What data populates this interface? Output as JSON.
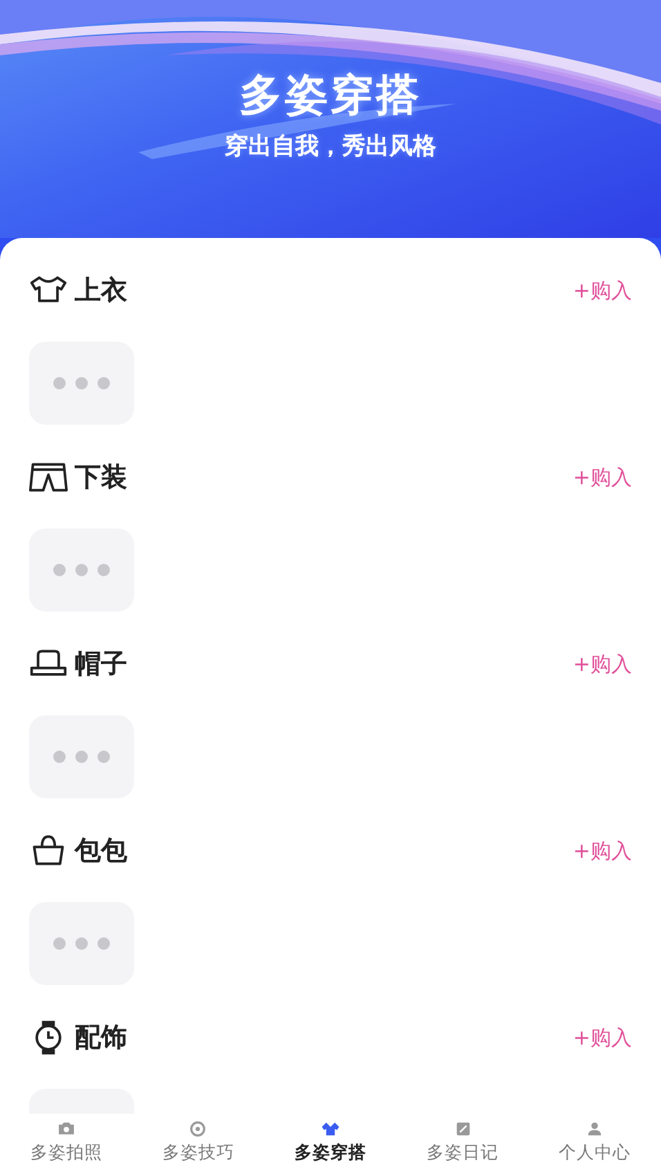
{
  "header": {
    "title": "多姿穿搭",
    "subtitle": "穿出自我，秀出风格"
  },
  "categories": [
    {
      "name": "上衣",
      "kind": "shirt",
      "action": "+购入"
    },
    {
      "name": "下装",
      "kind": "shorts",
      "action": "+购入"
    },
    {
      "name": "帽子",
      "kind": "hat",
      "action": "+购入"
    },
    {
      "name": "包包",
      "kind": "bag",
      "action": "+购入"
    },
    {
      "name": "配饰",
      "kind": "watch",
      "action": "+购入"
    }
  ],
  "tab_bar": [
    {
      "label": "多姿拍照",
      "kind": "camera",
      "selected": false
    },
    {
      "label": "多姿技巧",
      "kind": "tips",
      "selected": false
    },
    {
      "label": "多姿穿搭",
      "kind": "outfit",
      "selected": true
    },
    {
      "label": "多姿日记",
      "kind": "diary",
      "selected": false
    },
    {
      "label": "个人中心",
      "kind": "profile",
      "selected": false
    }
  ]
}
